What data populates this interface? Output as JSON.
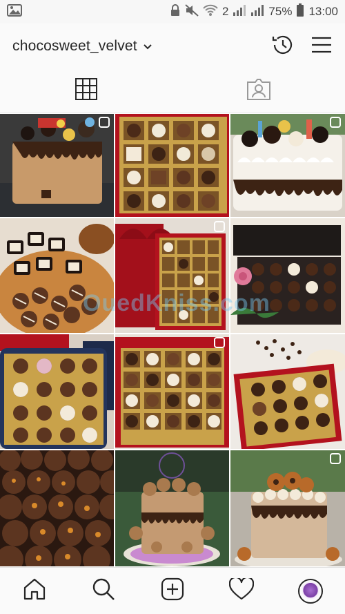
{
  "status_bar": {
    "battery": "75%",
    "time": "13:00",
    "sim_label": "2"
  },
  "profile": {
    "username": "chocosweet_velvet"
  },
  "icons": {
    "back": "image-icon",
    "history": "history-icon",
    "menu": "hamburger-menu-icon",
    "grid": "grid-icon",
    "tagged": "tagged-icon",
    "home": "home-icon",
    "search": "search-icon",
    "new_post": "new-post-icon",
    "activity": "heart-icon"
  },
  "posts": [
    {
      "name": "drip-cake-oreo",
      "multi": true
    },
    {
      "name": "gold-tray-assorted",
      "multi": false
    },
    {
      "name": "white-cream-drip-cake",
      "multi": true
    },
    {
      "name": "chocolate-platter",
      "multi": false
    },
    {
      "name": "red-gift-box-ribbon",
      "multi": true
    },
    {
      "name": "black-gift-box-rose",
      "multi": false
    },
    {
      "name": "blue-box-truffles",
      "multi": false
    },
    {
      "name": "red-gold-tray",
      "multi": true
    },
    {
      "name": "coffee-bean-box",
      "multi": false
    },
    {
      "name": "truffle-rows",
      "multi": false
    },
    {
      "name": "macaron-cake-dark",
      "multi": false
    },
    {
      "name": "macaron-drip-cake",
      "multi": true
    }
  ],
  "watermark": "OuedKniss.com",
  "colors": {
    "chocolate": "#3d2314",
    "gold": "#c9a24a",
    "red_box": "#b3121e",
    "cream": "#f3ead9"
  }
}
